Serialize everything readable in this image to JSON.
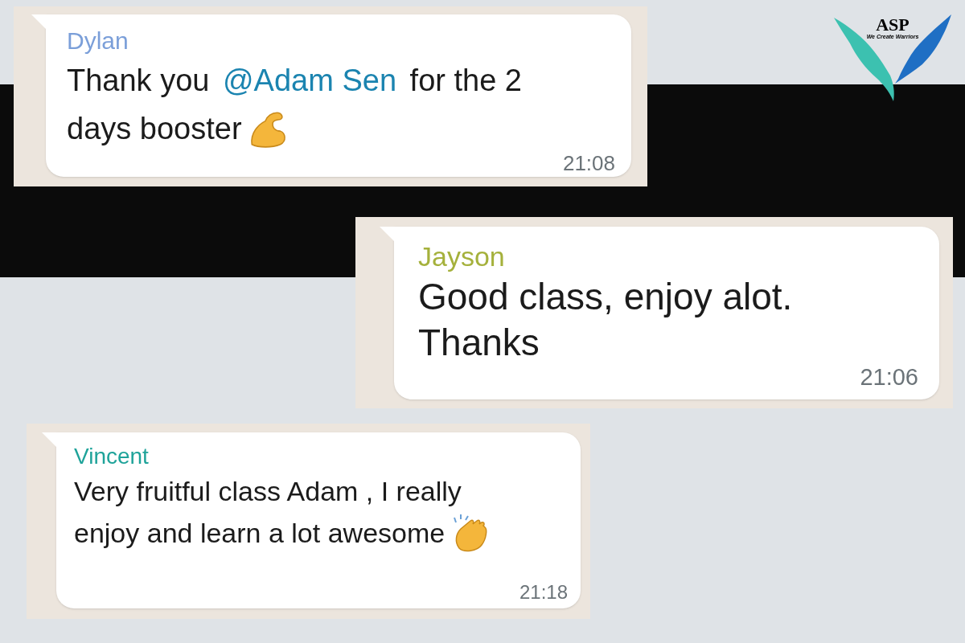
{
  "logo": {
    "title": "ASP",
    "tagline": "We Create Warriors"
  },
  "messages": [
    {
      "sender": "Dylan",
      "color": "#7b9fd9",
      "lines": [
        [
          {
            "kind": "text",
            "text": "Thank you "
          },
          {
            "kind": "mention",
            "text": "@Adam Sen"
          },
          {
            "kind": "text",
            "text": " for the 2"
          }
        ],
        [
          {
            "kind": "text",
            "text": "days booster"
          },
          {
            "kind": "flexed-arm-emoji"
          }
        ]
      ],
      "time": "21:08"
    },
    {
      "sender": "Jayson",
      "color": "#a5b13c",
      "lines": [
        [
          {
            "kind": "text",
            "text": "Good class, enjoy alot."
          }
        ],
        [
          {
            "kind": "text",
            "text": "Thanks"
          }
        ]
      ],
      "time": "21:06"
    },
    {
      "sender": "Vincent",
      "color": "#1fa39a",
      "lines": [
        [
          {
            "kind": "text",
            "text": "Very fruitful class Adam , I really"
          }
        ],
        [
          {
            "kind": "text",
            "text": "enjoy and learn a lot awesome"
          },
          {
            "kind": "clapping-hands-emoji"
          }
        ]
      ],
      "time": "21:18"
    }
  ]
}
